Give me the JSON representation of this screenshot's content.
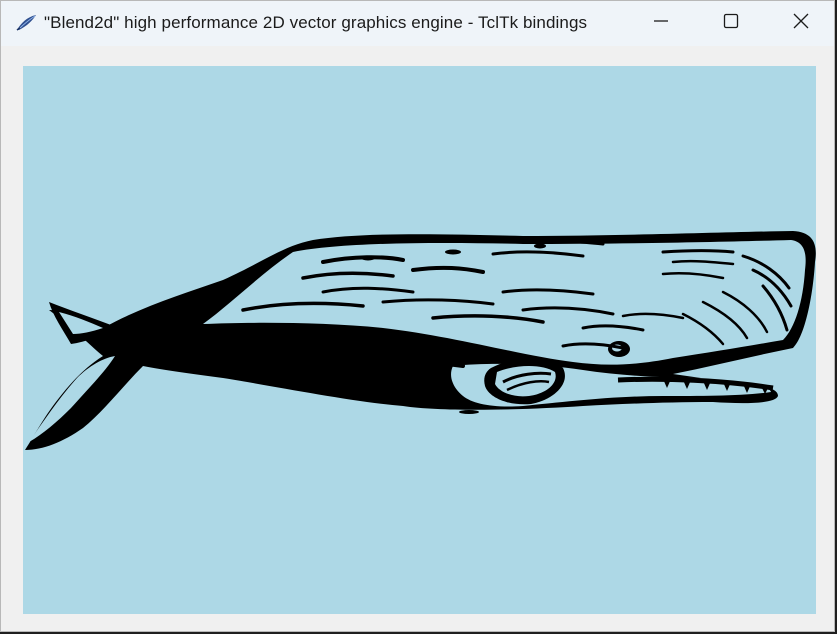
{
  "window": {
    "title": "\"Blend2d\" high performance 2D vector graphics engine - TclTk bindings",
    "icon": "feather-icon",
    "controls": [
      "minimize-icon",
      "maximize-icon",
      "close-icon"
    ]
  },
  "canvas": {
    "background": "#add8e6",
    "image": "sperm-whale-illustration",
    "ink_color": "#000000"
  }
}
